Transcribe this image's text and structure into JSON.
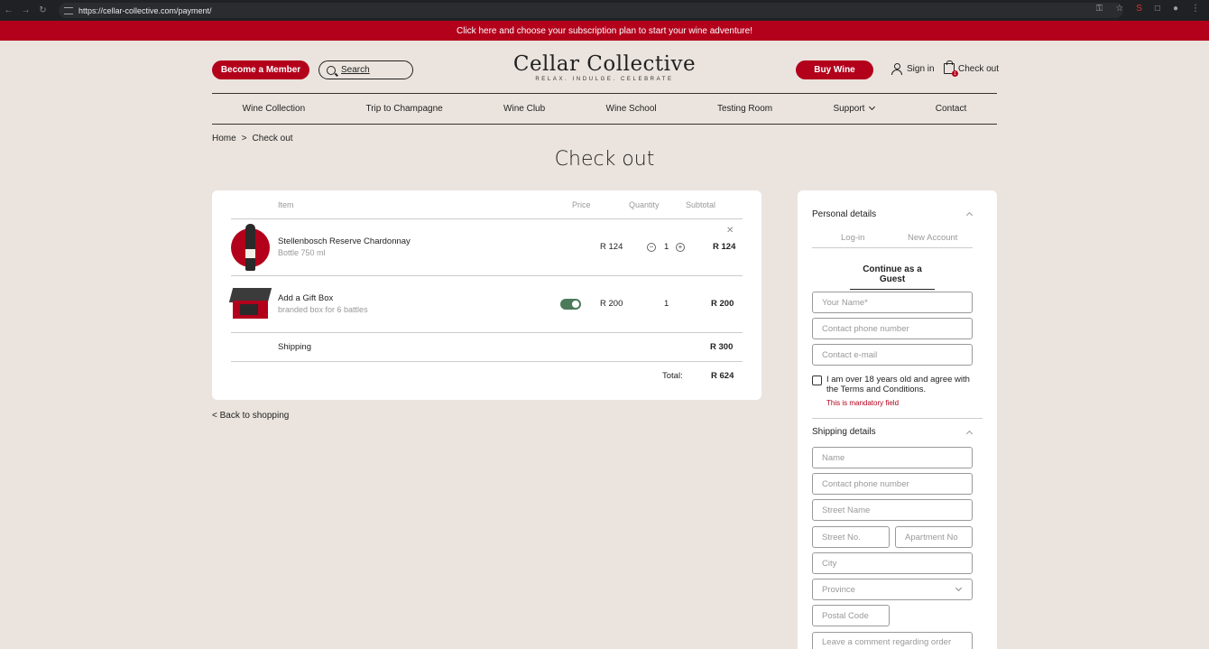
{
  "browser": {
    "url": "https://cellar-collective.com/payment/"
  },
  "promo": {
    "text": "Click here and choose your subscription plan to start your wine adventure!"
  },
  "header": {
    "member_label": "Become a Member",
    "search_label": "Search",
    "logo_name": "Cellar Collective",
    "logo_tagline": "RELAX. INDULGE. CELEBRATE",
    "buy_label": "Buy Wine",
    "signin_label": "Sign in",
    "checkout_label": "Check out",
    "cart_count": "1"
  },
  "nav": {
    "items": [
      "Wine Collection",
      "Trip to Champagne",
      "Wine Club",
      "Wine School",
      "Testing Room",
      "Support",
      "Contact"
    ]
  },
  "breadcrumb": {
    "home": "Home",
    "sep": ">",
    "current": "Check out"
  },
  "page_title": "Check out",
  "cart": {
    "headers": {
      "item": "Item",
      "price": "Price",
      "quantity": "Quantity",
      "subtotal": "Subtotal"
    },
    "items": [
      {
        "name": "Stellenbosch Reserve Chardonnay",
        "desc": "Bottle 750 ml",
        "price": "R 124",
        "qty": "1",
        "subtotal": "R 124"
      },
      {
        "name": "Add a Gift Box",
        "desc": "branded box for 6 battles",
        "price": "R 200",
        "qty": "1",
        "subtotal": "R 200"
      }
    ],
    "shipping_label": "Shipping",
    "shipping_value": "R 300",
    "total_label": "Total:",
    "total_value": "R 624",
    "gift_toggle_on": true
  },
  "back_label": "< Back to shopping",
  "personal": {
    "title": "Personal details",
    "tab_login": "Log-in",
    "tab_new": "New Account",
    "guest_label": "Continue as a Guest",
    "name_ph": "Your Name*",
    "phone_ph": "Contact phone number",
    "email_ph": "Contact e-mail",
    "agree_text": "I am over 18 years old and agree with the Terms and Conditions.",
    "mandatory": "This is mandatory field"
  },
  "shipping": {
    "title": "Shipping details",
    "name_ph": "Name",
    "phone_ph": "Contact phone number",
    "street_ph": "Street Name",
    "street_no_ph": "Street No.",
    "apt_ph": "Apartment No",
    "city_ph": "City",
    "province_ph": "Province",
    "postal_ph": "Postal Code",
    "comment_ph": "Leave a comment regarding order"
  },
  "colors": {
    "brand": "#b3001b",
    "background": "#ebe4de",
    "toggle": "#4a7a5a"
  }
}
